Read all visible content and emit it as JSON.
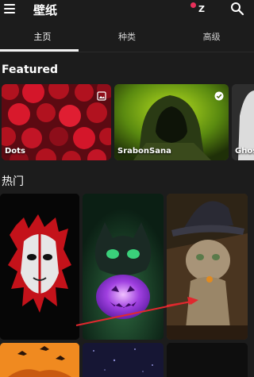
{
  "appbar": {
    "title": "壁纸",
    "avatar_letter": "Z"
  },
  "tabs": [
    {
      "label": "主页",
      "active": true
    },
    {
      "label": "种类",
      "active": false
    },
    {
      "label": "高级",
      "active": false
    }
  ],
  "featured": {
    "title": "Featured",
    "cards": [
      {
        "label": "Dots"
      },
      {
        "label": "SrabonSana"
      },
      {
        "label": "Ghos"
      }
    ]
  },
  "hot": {
    "title": "热门"
  },
  "colors": {
    "background": "#1c1c1c",
    "accent_dot": "#e8305a"
  }
}
